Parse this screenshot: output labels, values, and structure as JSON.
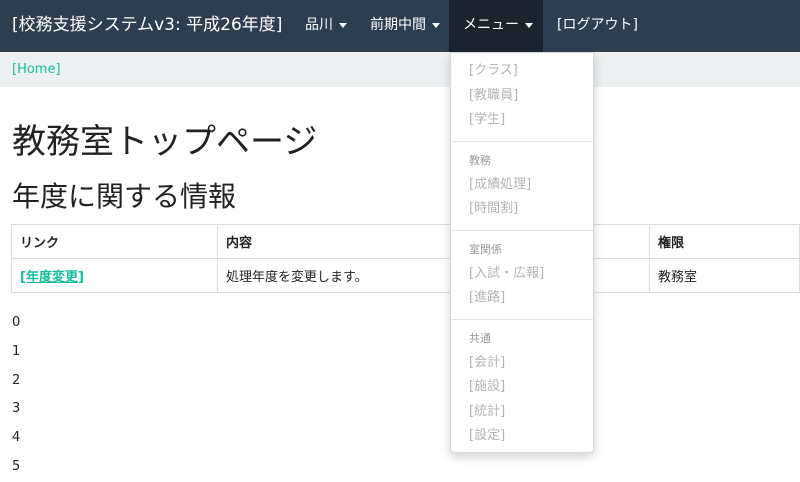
{
  "navbar": {
    "brand": "[校務支援システムv3: 平成26年度]",
    "items": [
      {
        "label": "品川"
      },
      {
        "label": "前期中間"
      },
      {
        "label": "メニュー"
      },
      {
        "label": "[ログアウト]"
      }
    ]
  },
  "breadcrumb": {
    "home": "[Home]"
  },
  "page": {
    "title": "教務室トップページ",
    "section_title": "年度に関する情報"
  },
  "table": {
    "headers": [
      "リンク",
      "内容",
      "権限"
    ],
    "rows": [
      {
        "link": "[年度変更]",
        "content": "処理年度を変更します。",
        "permission": "教務室"
      }
    ]
  },
  "numbers": [
    "0",
    "1",
    "2",
    "3",
    "4",
    "5"
  ],
  "dropdown": {
    "items_top": [
      "[クラス]",
      "[教職員]",
      "[学生]"
    ],
    "groups": [
      {
        "header": "教務",
        "items": [
          "[成績処理]",
          "[時間割]"
        ]
      },
      {
        "header": "室関係",
        "items": [
          "[入試・広報]",
          "[進路]"
        ]
      },
      {
        "header": "共通",
        "items": [
          "[会計]",
          "[施設]",
          "[統計]",
          "[設定]"
        ]
      }
    ]
  }
}
